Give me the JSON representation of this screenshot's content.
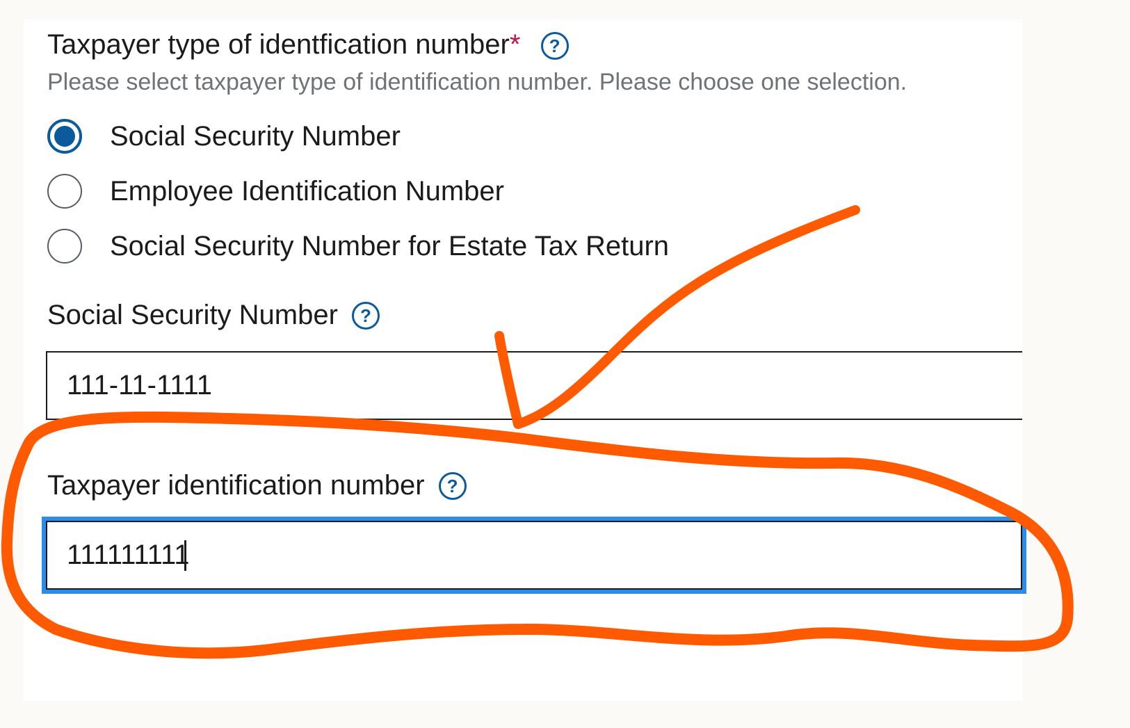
{
  "question": {
    "title": "Taxpayer type of identfication number",
    "required_mark": "*",
    "help_icon": "question-circle-icon",
    "hint": "Please select taxpayer type of identification number.  Please choose one selection."
  },
  "radio_options": [
    {
      "label": "Social Security Number",
      "selected": true
    },
    {
      "label": "Employee Identification Number",
      "selected": false
    },
    {
      "label": "Social Security Number for Estate Tax Return",
      "selected": false
    }
  ],
  "ssn_field": {
    "label": "Social Security Number",
    "value": "111-11-1111",
    "help_icon": "question-circle-icon"
  },
  "tin_field": {
    "label": "Taxpayer identification number",
    "value": "111111111",
    "focused": true,
    "help_icon": "question-circle-icon"
  },
  "annotation": {
    "shapes": [
      "checkmark",
      "loop"
    ],
    "color": "#ff5a00"
  },
  "colors": {
    "accent": "#0a5a9c",
    "focus_ring": "#2b8de8",
    "required": "#c0134a",
    "hint": "#6e7378"
  }
}
